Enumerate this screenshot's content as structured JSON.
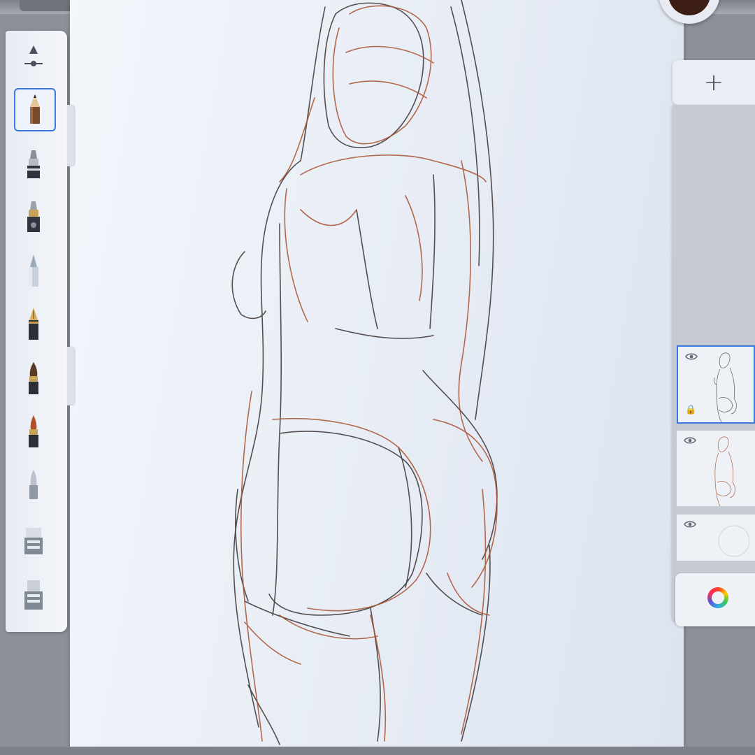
{
  "app": {
    "add_layer_label": "+",
    "current_color": "#3d1e14"
  },
  "tools": [
    {
      "name": "brush-size-slider-icon",
      "selected": false
    },
    {
      "name": "pencil-icon",
      "selected": true
    },
    {
      "name": "ballpoint-pen-icon",
      "selected": false
    },
    {
      "name": "marker-icon",
      "selected": false
    },
    {
      "name": "airbrush-icon",
      "selected": false
    },
    {
      "name": "fountain-pen-icon",
      "selected": false
    },
    {
      "name": "paintbrush-icon",
      "selected": false
    },
    {
      "name": "paintbrush-fine-icon",
      "selected": false
    },
    {
      "name": "smudge-icon",
      "selected": false
    },
    {
      "name": "eraser-icon",
      "selected": false
    },
    {
      "name": "hard-eraser-icon",
      "selected": false
    }
  ],
  "layers": [
    {
      "name": "sketch-layer-top",
      "visible": true,
      "locked": true,
      "active": true
    },
    {
      "name": "sketch-layer-red",
      "visible": true,
      "locked": false,
      "active": false
    },
    {
      "name": "empty-layer",
      "visible": true,
      "locked": false,
      "active": false
    }
  ],
  "colors": {
    "selection_accent": "#3b78e0",
    "stroke_dark": "#3a3232",
    "stroke_red": "#a9512f"
  }
}
